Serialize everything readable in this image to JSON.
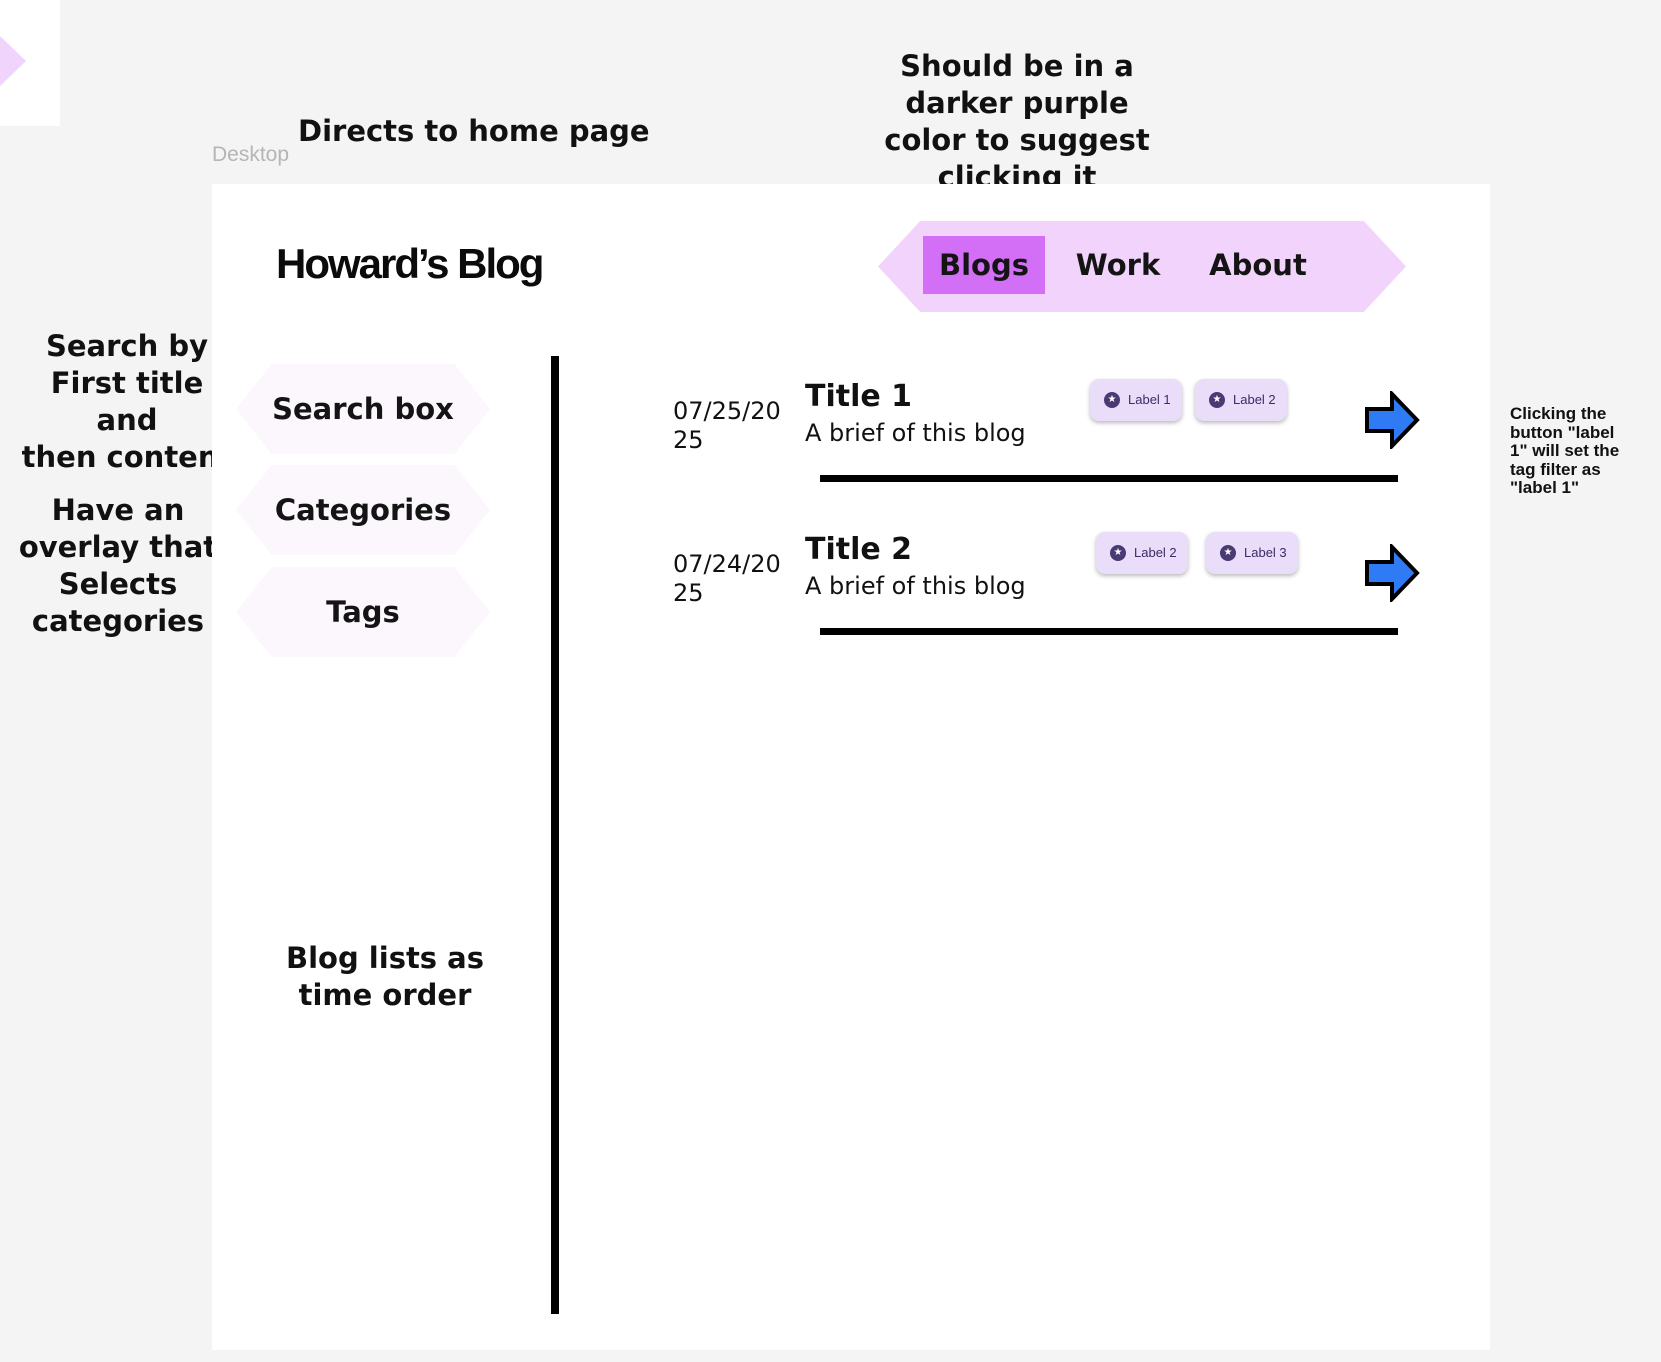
{
  "annotations": {
    "directs_home": "Directs to home page",
    "darker_purple": [
      "Should be in a",
      "darker purple",
      "color to suggest",
      "clicking it"
    ],
    "search_note": [
      "Search by",
      "First title and",
      "then content"
    ],
    "overlay_note": [
      "Have an",
      "overlay that",
      "Selects",
      "categories"
    ],
    "blog_list_note": [
      "Blog lists as",
      "time order"
    ],
    "label_click_note": [
      "Clicking the",
      "button \"label",
      "1\" will set the",
      "tag filter as",
      "\"label 1\""
    ]
  },
  "frame_label": "Desktop",
  "header": {
    "logo": "Howard’s Blog",
    "nav": [
      {
        "label": "Blogs",
        "active": true
      },
      {
        "label": "Work",
        "active": false
      },
      {
        "label": "About",
        "active": false
      }
    ]
  },
  "sidebar": {
    "search": "Search box",
    "categories": "Categories",
    "tags": "Tags"
  },
  "posts": [
    {
      "date": "07/25/2025",
      "title": "Title 1",
      "brief": "A brief of this blog",
      "labels": [
        "Label 1",
        "Label 2"
      ]
    },
    {
      "date": "07/24/2025",
      "title": "Title 2",
      "brief": "A brief of this blog",
      "labels": [
        "Label 2",
        "Label 3"
      ]
    }
  ],
  "colors": {
    "nav_bg": "#f1d3fb",
    "nav_active": "#d36ff6",
    "chip_bg": "#e9ddf9",
    "arrow": "#2f7bf5",
    "side_btn_bg": "#fcf7fd"
  },
  "icons": {
    "chip": "star-icon",
    "post_link": "arrow-right-icon"
  }
}
